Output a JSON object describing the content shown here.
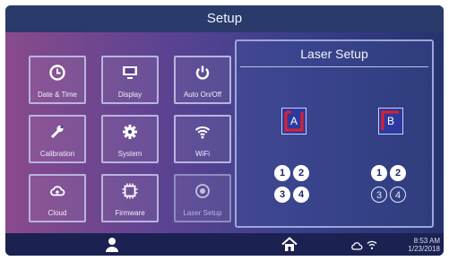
{
  "header": {
    "title": "Setup"
  },
  "tiles": [
    {
      "label": "Date & Time",
      "icon": "clock-icon"
    },
    {
      "label": "Display",
      "icon": "monitor-icon"
    },
    {
      "label": "Auto On/Off",
      "icon": "power-icon"
    },
    {
      "label": "Calibration",
      "icon": "wrench-icon"
    },
    {
      "label": "System",
      "icon": "gear-icon"
    },
    {
      "label": "WiFi",
      "icon": "wifi-icon"
    },
    {
      "label": "Cloud",
      "icon": "cloud-icon"
    },
    {
      "label": "Firmware",
      "icon": "chip-icon"
    },
    {
      "label": "Laser Setup",
      "icon": "target-icon"
    }
  ],
  "laser_setup": {
    "title": "Laser Setup",
    "laser_a": {
      "label": "A",
      "positions": [
        "1",
        "2",
        "3",
        "4"
      ]
    },
    "laser_b": {
      "label": "B",
      "positions": [
        "1",
        "2",
        "3",
        "4"
      ]
    }
  },
  "status_bar": {
    "time": "8:53 AM",
    "date": "1/23/2018"
  },
  "colors": {
    "accent_red": "#e0202a",
    "tile_border": "#b9b4df",
    "panel_bg": "#2c3aa0"
  }
}
